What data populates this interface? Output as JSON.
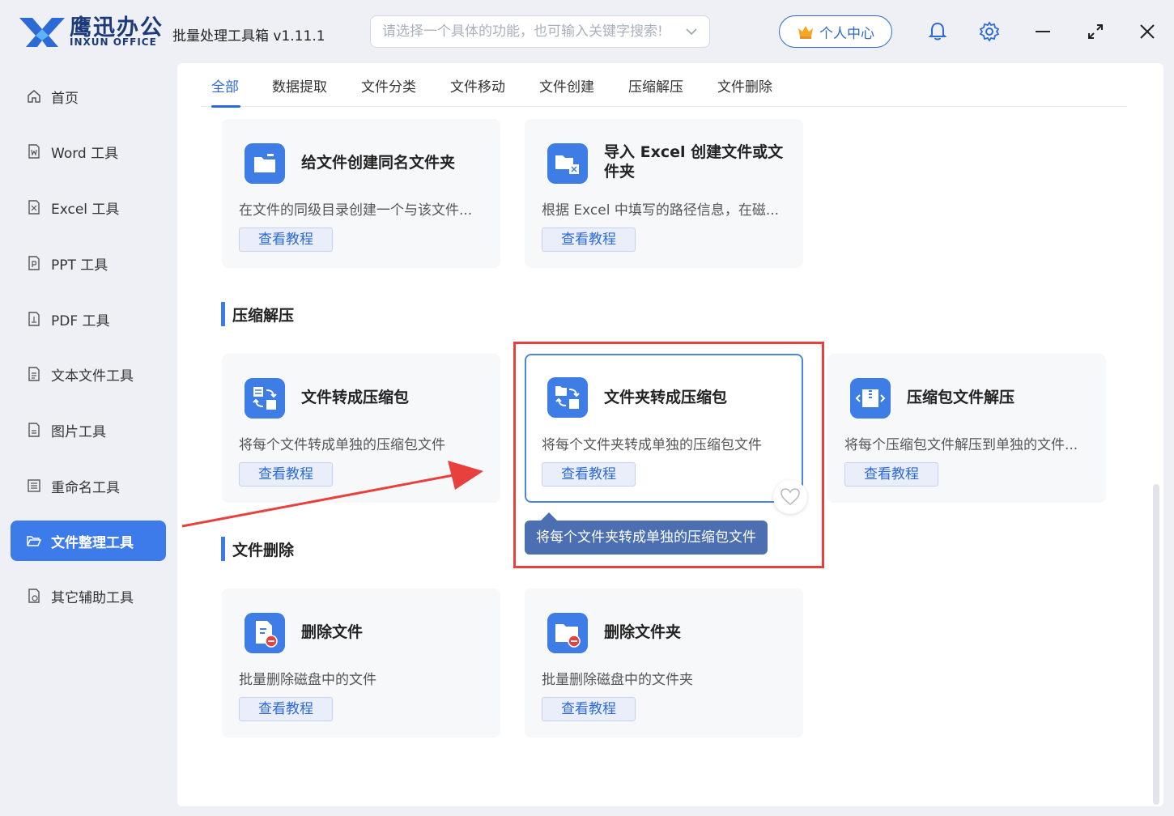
{
  "app": {
    "brand_cn": "鹰迅办公",
    "brand_en": "INXUN OFFICE",
    "title": "批量处理工具箱 v1.11.1",
    "search_placeholder": "请选择一个具体的功能，也可输入关键字搜索!",
    "user_center": "个人中心"
  },
  "sidebar": {
    "items": [
      {
        "label": "首页",
        "icon": "home-icon"
      },
      {
        "label": "Word 工具",
        "icon": "word-file-icon"
      },
      {
        "label": "Excel 工具",
        "icon": "excel-file-icon"
      },
      {
        "label": "PPT 工具",
        "icon": "ppt-file-icon"
      },
      {
        "label": "PDF 工具",
        "icon": "pdf-file-icon"
      },
      {
        "label": "文本文件工具",
        "icon": "text-file-icon"
      },
      {
        "label": "图片工具",
        "icon": "image-file-icon"
      },
      {
        "label": "重命名工具",
        "icon": "rename-icon"
      },
      {
        "label": "文件整理工具",
        "icon": "folder-open-icon",
        "active": true
      },
      {
        "label": "其它辅助工具",
        "icon": "tools-icon"
      }
    ]
  },
  "tabs": [
    "全部",
    "数据提取",
    "文件分类",
    "文件移动",
    "文件创建",
    "压缩解压",
    "文件删除"
  ],
  "cards_top": [
    {
      "title": "给文件创建同名文件夹",
      "desc": "在文件的同级目录创建一个与该文件...",
      "btn": "查看教程"
    },
    {
      "title": "导入 Excel 创建文件或文件夹",
      "desc": "根据 Excel 中填写的路径信息，在磁...",
      "btn": "查看教程"
    }
  ],
  "section_compress": "压缩解压",
  "cards_compress": [
    {
      "title": "文件转成压缩包",
      "desc": "将每个文件转成单独的压缩包文件",
      "btn": "查看教程"
    },
    {
      "title": "文件夹转成压缩包",
      "desc": "将每个文件夹转成单独的压缩包文件",
      "btn": "查看教程"
    },
    {
      "title": "压缩包文件解压",
      "desc": "将每个压缩包文件解压到单独的文件...",
      "btn": "查看教程"
    }
  ],
  "tooltip": "将每个文件夹转成单独的压缩包文件",
  "section_delete": "文件删除",
  "cards_delete": [
    {
      "title": "删除文件",
      "desc": "批量删除磁盘中的文件",
      "btn": "查看教程"
    },
    {
      "title": "删除文件夹",
      "desc": "批量删除磁盘中的文件夹",
      "btn": "查看教程"
    }
  ],
  "colors": {
    "accent": "#3d7bea",
    "highlight": "#e8413d",
    "tooltip": "#4b6fb0"
  }
}
